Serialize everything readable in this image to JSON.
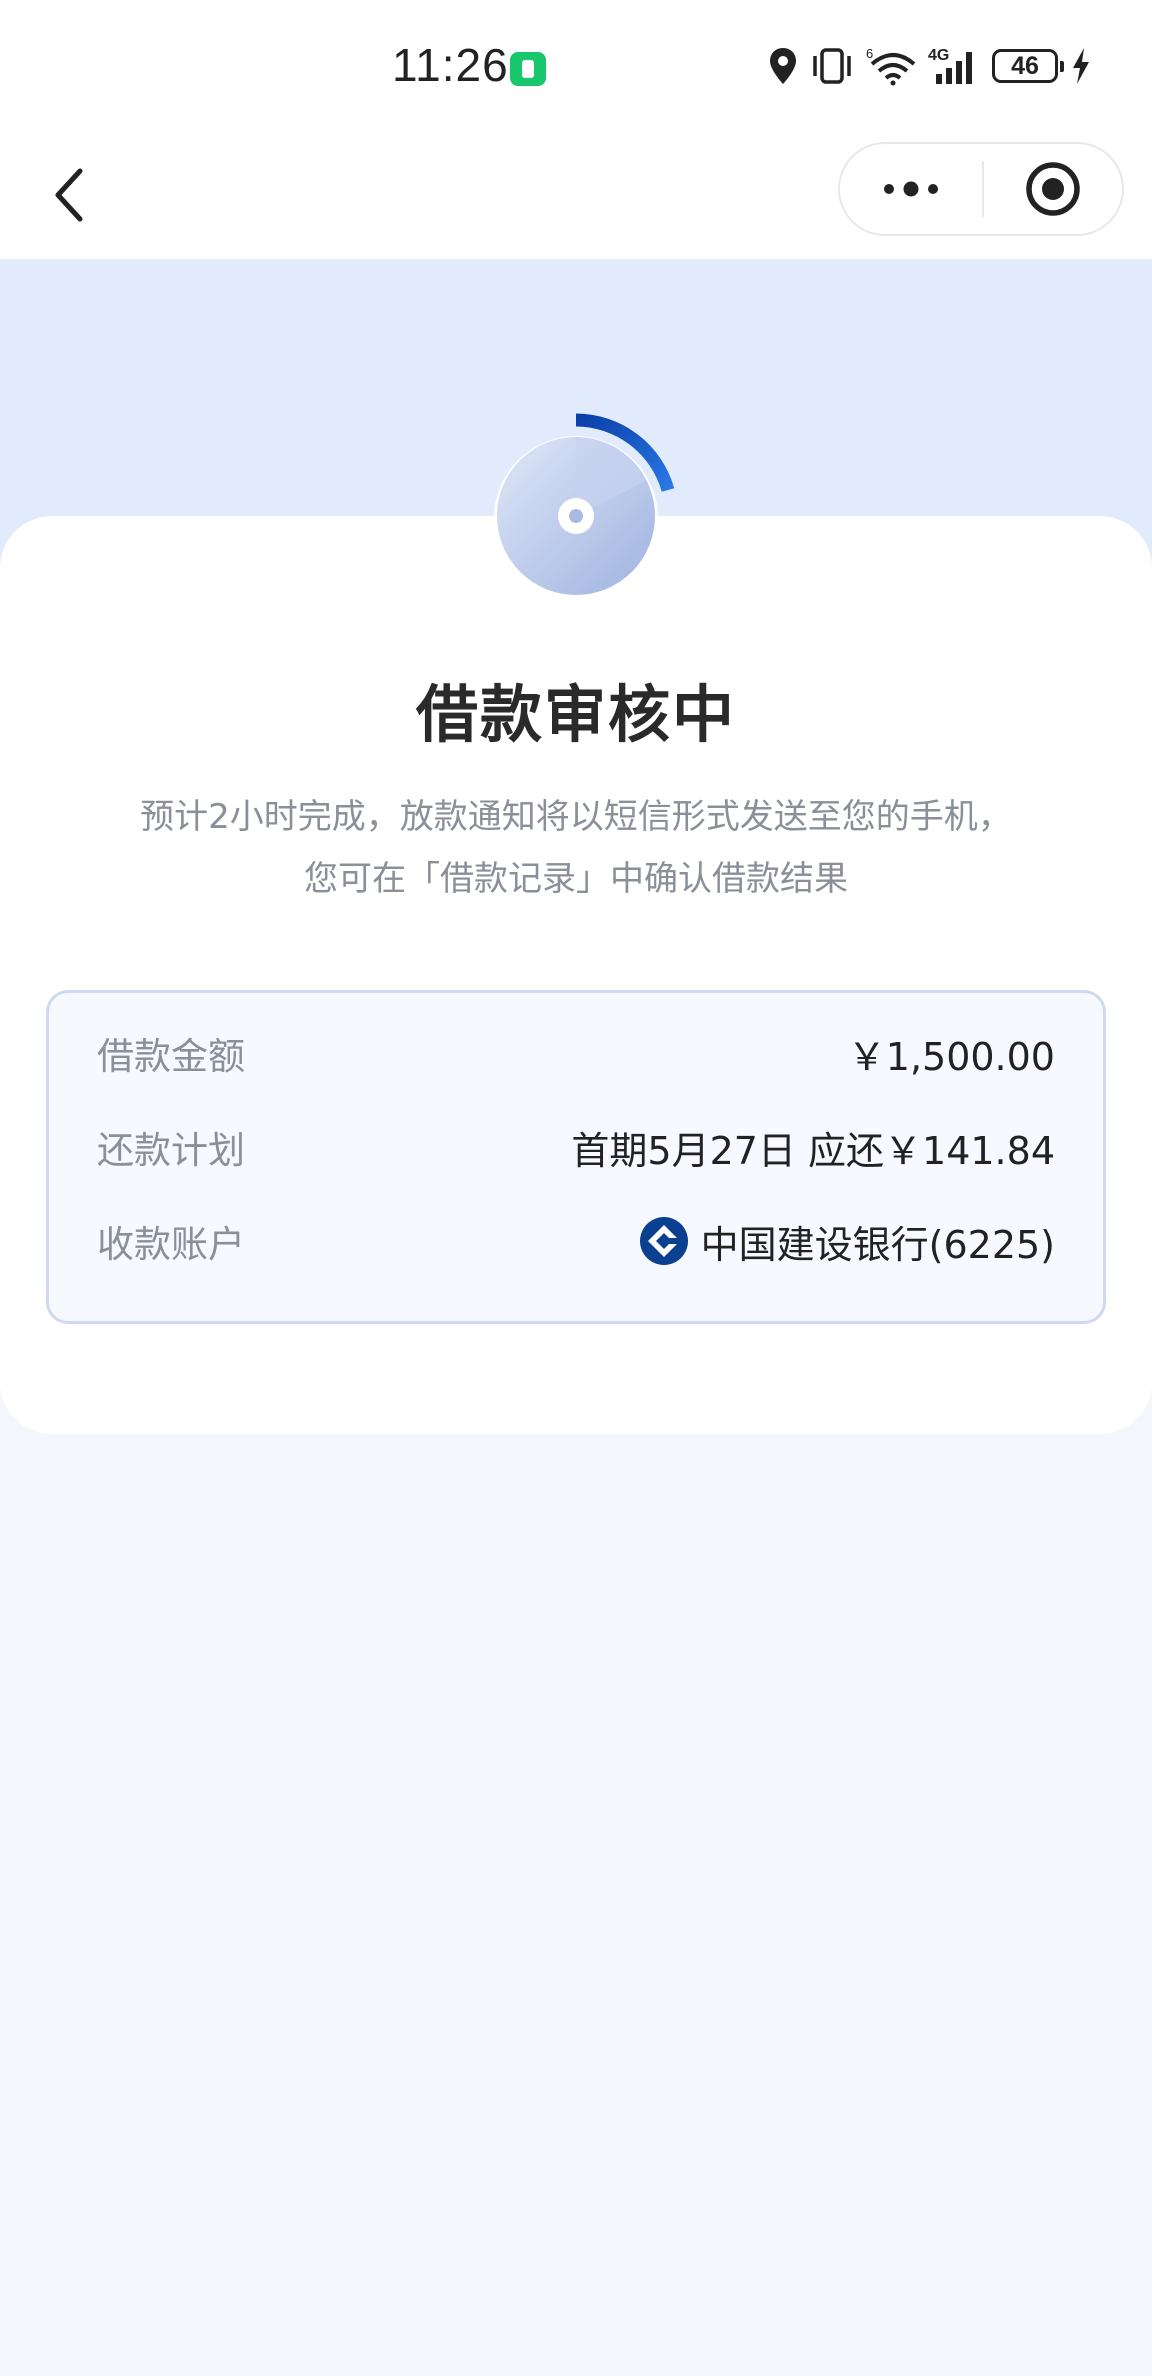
{
  "status_bar": {
    "time": "11:26",
    "network": "4G",
    "network_sub": "6",
    "battery": "46"
  },
  "nav": {
    "back_icon": "chevron-left-icon",
    "more_icon": "more-dots-icon",
    "close_icon": "target-close-icon"
  },
  "status": {
    "icon": "pending-clock-icon",
    "title": "借款审核中",
    "description": "预计2小时完成，放款通知将以短信形式发送至您的手机，您可在「借款记录」中确认借款结果"
  },
  "loan_info": {
    "rows": [
      {
        "label": "借款金额",
        "value": "￥1,500.00"
      },
      {
        "label": "还款计划",
        "value": "首期5月27日 应还￥141.84"
      },
      {
        "label": "收款账户",
        "value": "中国建设银行(6225)",
        "icon": "ccb-bank-logo"
      }
    ]
  },
  "colors": {
    "hero_bg": "#e2ebfc",
    "accent_blue": "#1a56c4",
    "page_bg": "#f3f6fc"
  }
}
